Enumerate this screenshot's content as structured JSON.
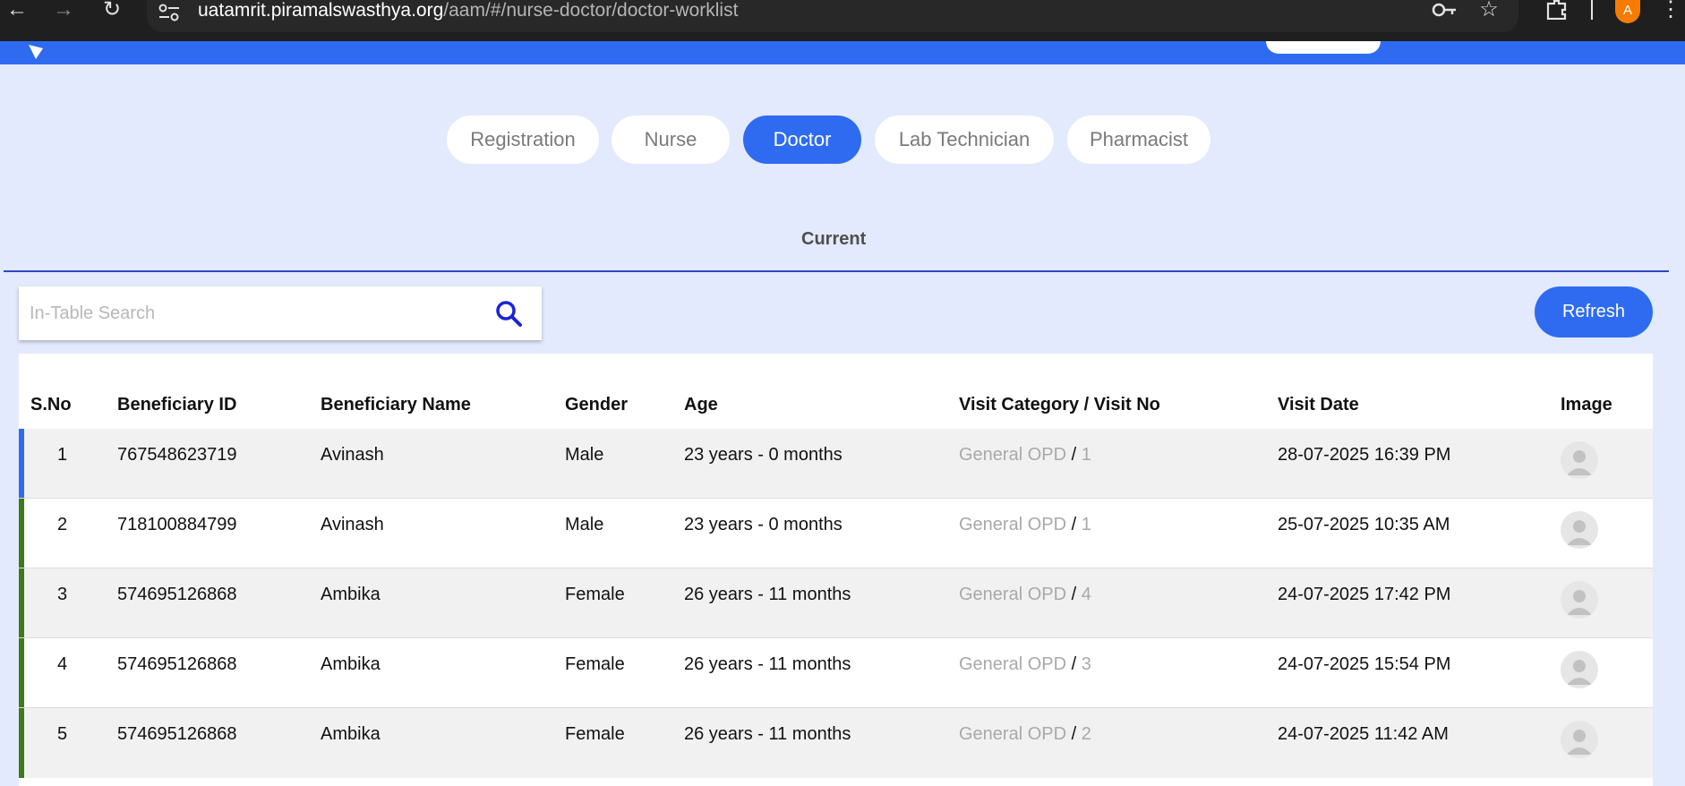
{
  "browser": {
    "url_host": "uatamrit.piramalswasthya.org",
    "url_path": "/aam/#/nurse-doctor/doctor-worklist",
    "profile_initial": "A",
    "icons": [
      "back-icon",
      "forward-icon",
      "reload-icon",
      "site-settings-icon",
      "key-icon",
      "star-icon",
      "extensions-icon",
      "menu-icon"
    ]
  },
  "role_tabs": [
    {
      "label": "Registration"
    },
    {
      "label": "Nurse"
    },
    {
      "label": "Doctor",
      "active": true
    },
    {
      "label": "Lab Technician"
    },
    {
      "label": "Pharmacist"
    }
  ],
  "sub_tab": "Current",
  "search": {
    "placeholder": "In-Table Search"
  },
  "refresh_label": "Refresh",
  "table": {
    "headers": [
      "S.No",
      "Beneficiary ID",
      "Beneficiary Name",
      "Gender",
      "Age",
      "Visit Category / Visit No",
      "Visit Date",
      "Image"
    ],
    "rows": [
      {
        "sno": "1",
        "id": "767548623719",
        "name": "Avinash",
        "gender": "Male",
        "age": "23 years - 0 months",
        "category": "General OPD",
        "visit_no": "1",
        "date": "28-07-2025 16:39 PM",
        "bar_color": "#2f6bf0"
      },
      {
        "sno": "2",
        "id": "718100884799",
        "name": "Avinash",
        "gender": "Male",
        "age": "23 years - 0 months",
        "category": "General OPD",
        "visit_no": "1",
        "date": "25-07-2025 10:35 AM",
        "bar_color": "#3d7a1a"
      },
      {
        "sno": "3",
        "id": "574695126868",
        "name": "Ambika",
        "gender": "Female",
        "age": "26 years - 11 months",
        "category": "General OPD",
        "visit_no": "4",
        "date": "24-07-2025 17:42 PM",
        "bar_color": "#3d7a1a"
      },
      {
        "sno": "4",
        "id": "574695126868",
        "name": "Ambika",
        "gender": "Female",
        "age": "26 years - 11 months",
        "category": "General OPD",
        "visit_no": "3",
        "date": "24-07-2025 15:54 PM",
        "bar_color": "#3d7a1a"
      },
      {
        "sno": "5",
        "id": "574695126868",
        "name": "Ambika",
        "gender": "Female",
        "age": "26 years - 11 months",
        "category": "General OPD",
        "visit_no": "2",
        "date": "24-07-2025 11:42 AM",
        "bar_color": "#3d7a1a"
      }
    ]
  }
}
